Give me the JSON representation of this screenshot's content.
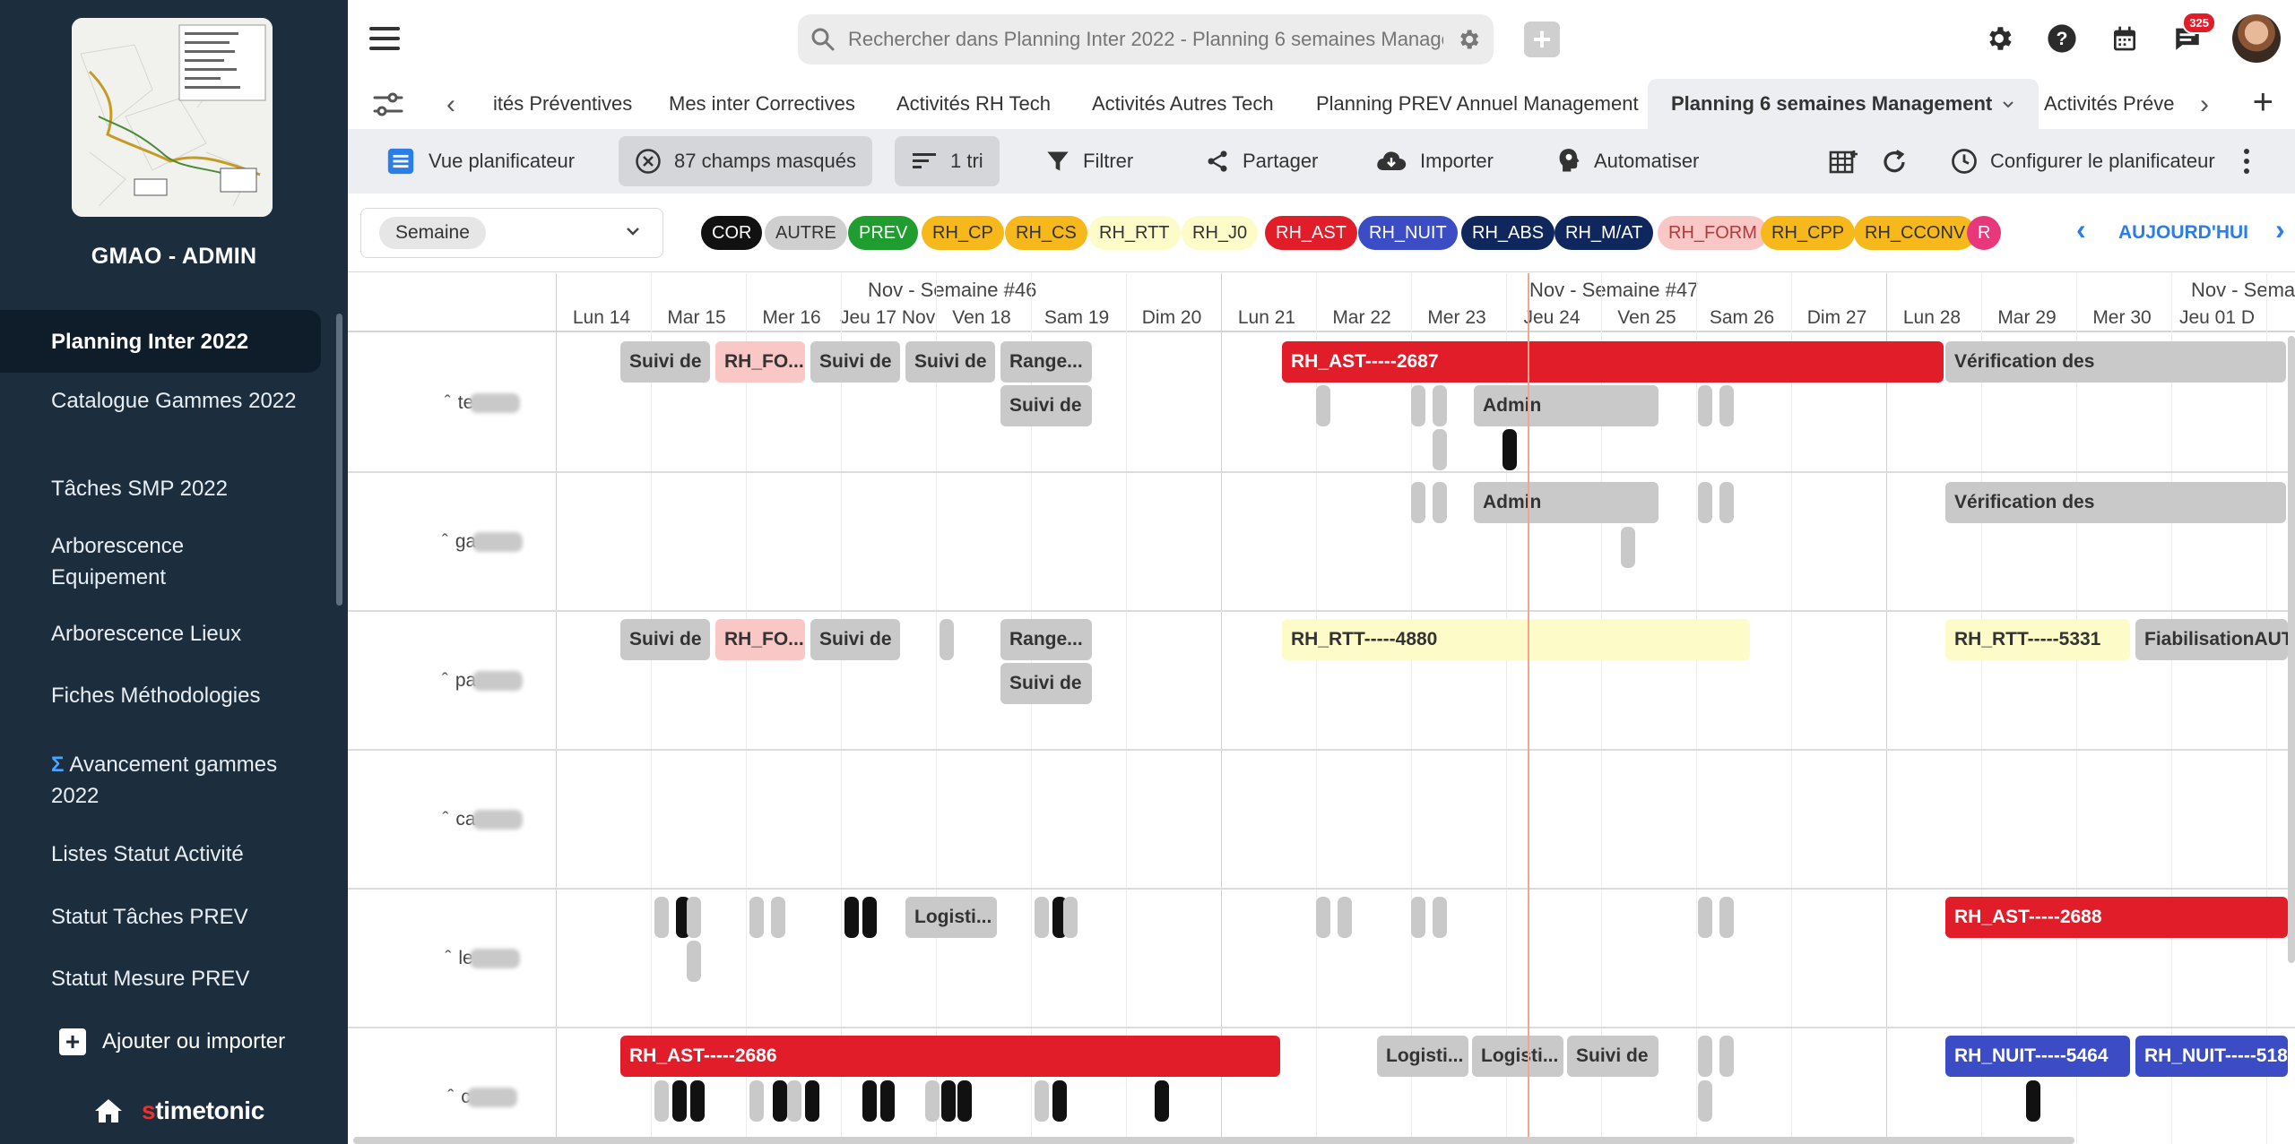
{
  "sidebar": {
    "app_name": "GMAO - ADMIN",
    "items": [
      {
        "label": "Planning Inter 2022",
        "active": true
      },
      {
        "label": "Catalogue Gammes 2022"
      },
      {
        "label": "Tâches SMP 2022"
      },
      {
        "label": "Arborescence Equipement"
      },
      {
        "label": "Arborescence Lieux"
      },
      {
        "label": "Fiches Méthodologies"
      },
      {
        "label": "Avancement gammes 2022",
        "prefix": "Σ"
      },
      {
        "label": "Listes Statut Activité"
      },
      {
        "label": "Statut Tâches PREV"
      },
      {
        "label": "Statut Mesure PREV"
      }
    ],
    "add_import": "Ajouter ou importer",
    "brand": {
      "s": "s",
      "rest": "timetonic"
    }
  },
  "topbar": {
    "search_placeholder": "Rechercher dans Planning Inter 2022 - Planning 6 semaines Management",
    "notif_count": "325"
  },
  "tabs": {
    "items": [
      {
        "label": "ités Préventives"
      },
      {
        "label": "Mes inter Correctives"
      },
      {
        "label": "Activités RH Tech"
      },
      {
        "label": "Activités Autres Tech"
      },
      {
        "label": "Planning PREV Annuel Management"
      },
      {
        "label": "Planning 6 semaines Management",
        "active": true
      },
      {
        "label": "Activités Préve"
      }
    ]
  },
  "toolbar": {
    "view": "Vue planificateur",
    "hidden_fields": "87 champs masqués",
    "sort": "1 tri",
    "filter": "Filtrer",
    "share": "Partager",
    "import": "Importer",
    "automate": "Automatiser",
    "configure": "Configurer le planificateur"
  },
  "legend": {
    "period": "Semaine",
    "today": "AUJOURD'HUI",
    "chips": [
      {
        "label": "COR",
        "bg": "#111111",
        "fg": "#ffffff"
      },
      {
        "label": "AUTRE",
        "bg": "#cfcfcf",
        "fg": "#333333"
      },
      {
        "label": "PREV",
        "bg": "#1f9d2e",
        "fg": "#ffffff"
      },
      {
        "label": "RH_CP",
        "bg": "#f6b81a",
        "fg": "#333333"
      },
      {
        "label": "RH_CS",
        "bg": "#f6b81a",
        "fg": "#333333"
      },
      {
        "label": "RH_RTT",
        "bg": "#fdfbc8",
        "fg": "#333333"
      },
      {
        "label": "RH_J0",
        "bg": "#fdfbc8",
        "fg": "#333333"
      },
      {
        "label": "RH_AST",
        "bg": "#e11d2a",
        "fg": "#ffffff"
      },
      {
        "label": "RH_NUIT",
        "bg": "#3b4cc4",
        "fg": "#ffffff"
      },
      {
        "label": "RH_ABS",
        "bg": "#10275e",
        "fg": "#ffffff"
      },
      {
        "label": "RH_M/AT",
        "bg": "#10275e",
        "fg": "#ffffff"
      },
      {
        "label": "RH_FORM",
        "bg": "#f9c8c6",
        "fg": "#b23a3a"
      },
      {
        "label": "RH_CPP",
        "bg": "#f6b81a",
        "fg": "#333333"
      },
      {
        "label": "RH_CCONV",
        "bg": "#f6b81a",
        "fg": "#333333"
      },
      {
        "label": "R",
        "bg": "#e8377a",
        "fg": "#ffffff"
      }
    ]
  },
  "calendar": {
    "weeks": [
      "Nov - Semaine #46",
      "Nov - Semaine #47",
      "Nov - Semai"
    ],
    "days": [
      "Lun 14",
      "Mar 15",
      "Mer 16",
      "Jeu 17 Nov",
      "Ven 18",
      "Sam 19",
      "Dim 20",
      "Lun 21",
      "Mar 22",
      "Mer 23",
      "Jeu 24",
      "Ven 25",
      "Sam 26",
      "Dim 27",
      "Lun 28",
      "Mar 29",
      "Mer 30",
      "Jeu 01 D"
    ],
    "rows": [
      {
        "name": "te"
      },
      {
        "name": "ga"
      },
      {
        "name": "pa"
      },
      {
        "name": "ca"
      },
      {
        "name": "le"
      },
      {
        "name": "c"
      }
    ],
    "events": {
      "suivi": "Suivi de",
      "rh_fo": "RH_FO...",
      "range": "Range...",
      "rh_ast_2687": "RH_AST-----2687",
      "verif": "Vérification des",
      "admin": "Admin",
      "rh_rtt_4880": "RH_RTT-----4880",
      "rh_rtt_5331": "RH_RTT-----5331",
      "fiabilisation": "FiabilisationAUT",
      "logisti": "Logisti...",
      "rh_ast_2688": "RH_AST-----2688",
      "rh_ast_2686": "RH_AST-----2686",
      "rh_nuit_5464": "RH_NUIT-----5464",
      "rh_nuit_518": "RH_NUIT-----518"
    }
  }
}
